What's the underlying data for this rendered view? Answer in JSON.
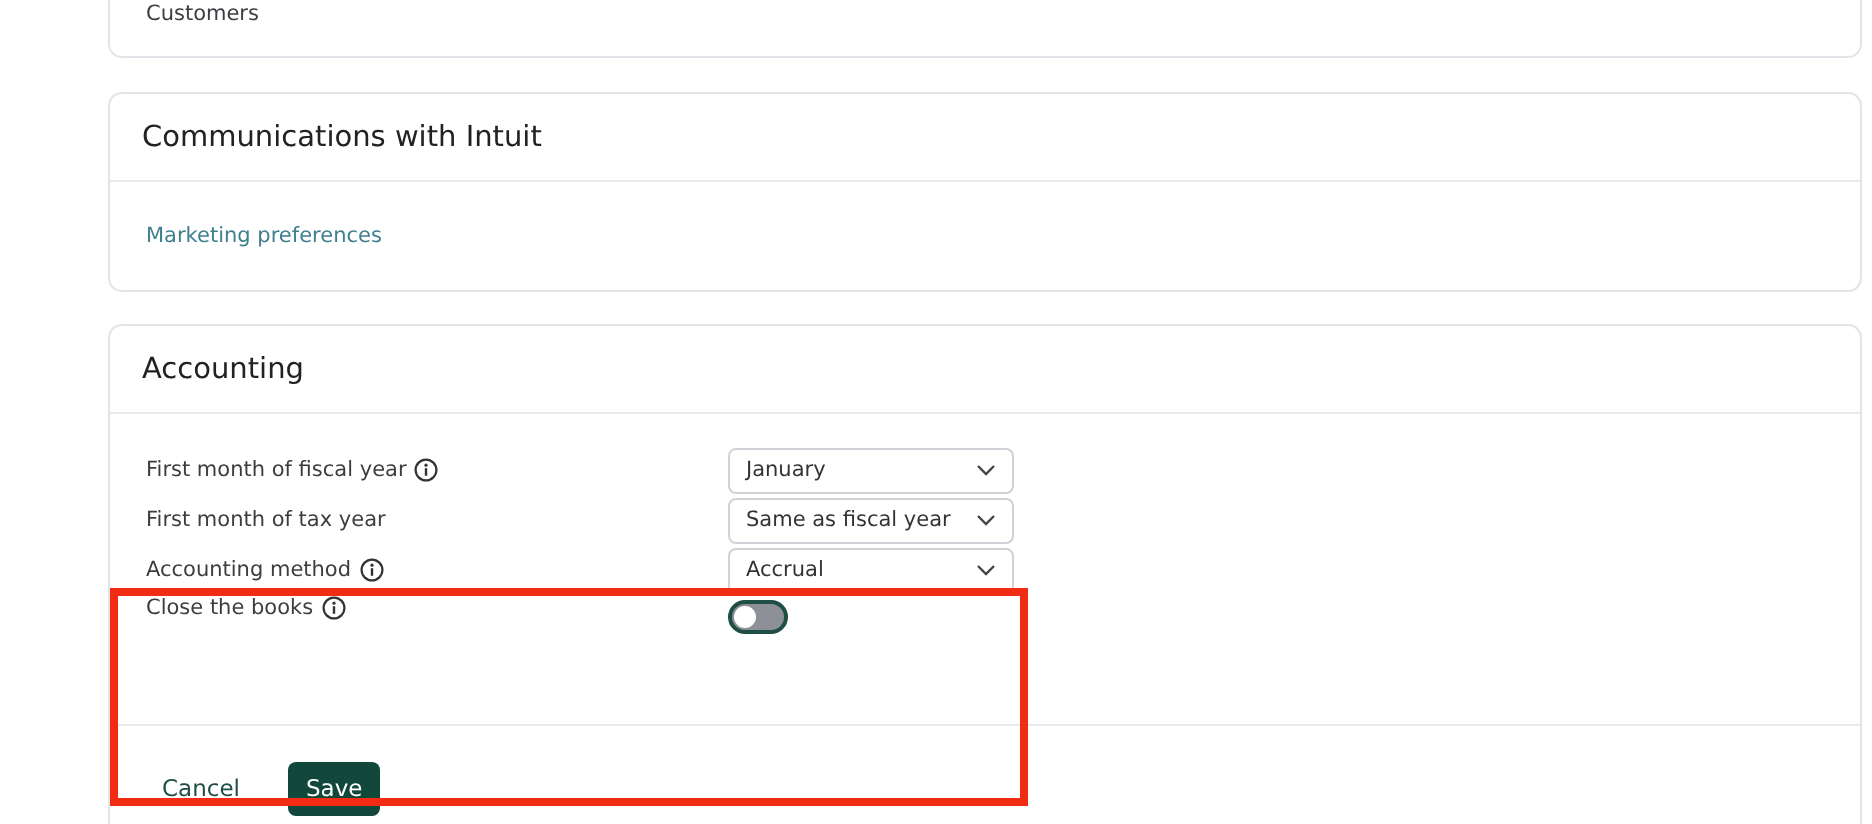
{
  "customers_card": {
    "text": "Customers"
  },
  "communications": {
    "title": "Communications with Intuit",
    "link": "Marketing preferences"
  },
  "accounting": {
    "title": "Accounting",
    "rows": [
      {
        "kind": "select",
        "label": "First month of fiscal year",
        "info": true,
        "value": "January"
      },
      {
        "kind": "select",
        "label": "First month of tax year",
        "info": false,
        "value": "Same as fiscal year"
      },
      {
        "kind": "select",
        "label": "Accounting method",
        "info": true,
        "value": "Accrual"
      },
      {
        "kind": "toggle",
        "label": "Close the books",
        "info": true,
        "on": false
      }
    ],
    "buttons": {
      "cancel": "Cancel",
      "save": "Save"
    }
  }
}
